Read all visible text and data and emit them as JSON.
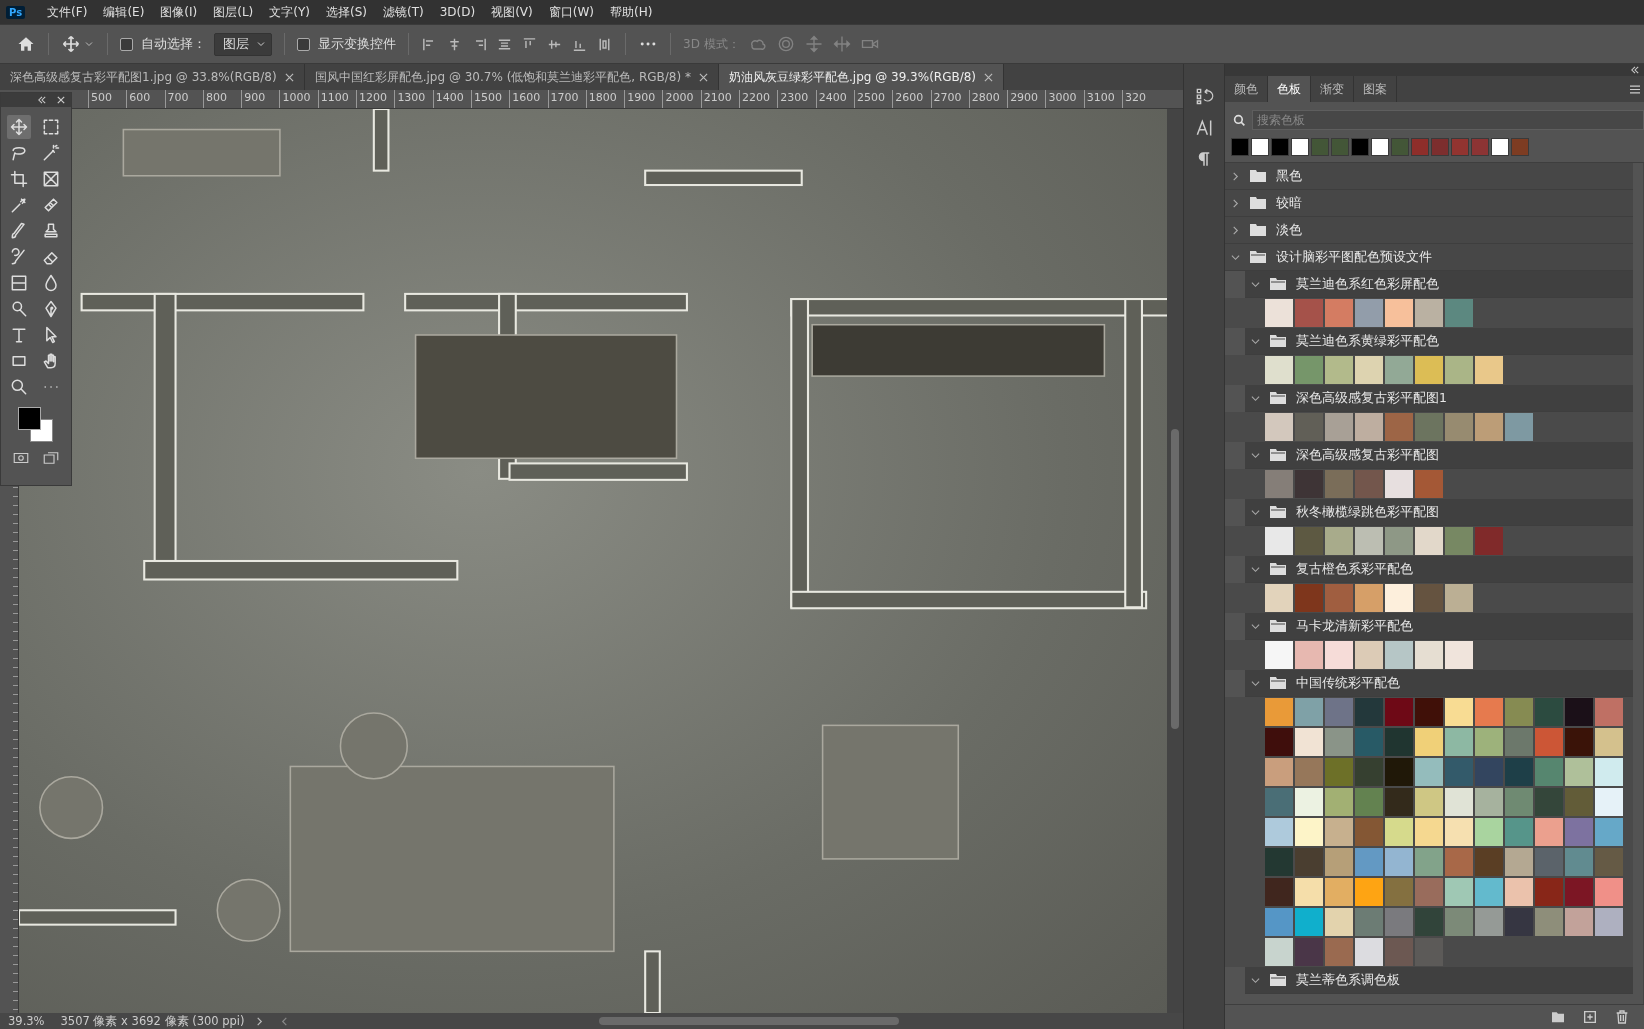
{
  "app": {
    "logo": "Ps"
  },
  "menu": [
    "文件(F)",
    "编辑(E)",
    "图像(I)",
    "图层(L)",
    "文字(Y)",
    "选择(S)",
    "滤镜(T)",
    "3D(D)",
    "视图(V)",
    "窗口(W)",
    "帮助(H)"
  ],
  "options_bar": {
    "auto_select": {
      "label": "自动选择：",
      "checked": false
    },
    "layer_dropdown": "图层",
    "show_transform": {
      "label": "显示变换控件",
      "checked": false
    },
    "mode_3d": "3D 模式："
  },
  "document_tabs": [
    {
      "title": "深色高级感复古彩平配图1.jpg @ 33.8%(RGB/8)",
      "selected": false
    },
    {
      "title": "国风中国红彩屏配色.jpg @ 30.7% (低饱和莫兰迪彩平配色, RGB/8) *",
      "selected": false
    },
    {
      "title": "奶油风灰豆绿彩平配色.jpg @ 39.3%(RGB/8)",
      "selected": true
    }
  ],
  "ruler_marks": [
    "500",
    "600",
    "700",
    "800",
    "900",
    "1000",
    "1100",
    "1200",
    "1300",
    "1400",
    "1500",
    "1600",
    "1700",
    "1800",
    "1900",
    "2000",
    "2100",
    "2200",
    "2300",
    "2400",
    "2500",
    "2600",
    "2700",
    "2800",
    "2900",
    "3000",
    "3100",
    "320"
  ],
  "status_bar": {
    "zoom": "39.3%",
    "info": "3507 像素 x 3692 像素 (300 ppi)"
  },
  "panel": {
    "tabs": [
      {
        "label": "颜色",
        "selected": false
      },
      {
        "label": "色板",
        "selected": true
      },
      {
        "label": "渐变",
        "selected": false
      },
      {
        "label": "图案",
        "selected": false
      }
    ],
    "search": {
      "placeholder": "搜索色板"
    },
    "recent": [
      {
        "color": "#000000"
      },
      {
        "color": "#ffffff"
      },
      {
        "color": "#000000"
      },
      {
        "color": "#ffffff"
      },
      {
        "color": "#435637"
      },
      {
        "color": "#435637"
      },
      {
        "color": "#000000"
      },
      {
        "color": "#ffffff"
      },
      {
        "color": "#435637"
      },
      {
        "color": "#8e2e2a"
      },
      {
        "color": "#7c2e2e"
      },
      {
        "color": "#923430"
      },
      {
        "color": "#8c3434"
      },
      {
        "color": "#ffffff"
      },
      {
        "color": "#7d3c22"
      }
    ],
    "groups": [
      {
        "name": "黑色",
        "expanded": false
      },
      {
        "name": "较暗",
        "expanded": false
      },
      {
        "name": "淡色",
        "expanded": false
      },
      {
        "name": "设计脑彩平图配色预设文件",
        "expanded": true,
        "children": [
          {
            "name": "莫兰迪色系红色彩屏配色",
            "expanded": true,
            "swatches": [
              {
                "color": "#ece1d9"
              },
              {
                "color": "#a5524a"
              },
              {
                "color": "#d47c62"
              },
              {
                "color": "#929daa"
              },
              {
                "color": "#f7c09b"
              },
              {
                "color": "#bab1a2"
              },
              {
                "color": "#5c8880"
              }
            ]
          },
          {
            "name": "莫兰迪色系黄绿彩平配色",
            "expanded": true,
            "swatches": [
              {
                "color": "#dfdfcd"
              },
              {
                "color": "#76966a"
              },
              {
                "color": "#b2ba8b"
              },
              {
                "color": "#ddd3b0"
              },
              {
                "color": "#92a996"
              },
              {
                "color": "#dcbd55"
              },
              {
                "color": "#aab587"
              },
              {
                "color": "#e9c88a"
              }
            ]
          },
          {
            "name": "深色高级感复古彩平配图1",
            "expanded": true,
            "swatches": [
              {
                "color": "#d3c8bd"
              },
              {
                "color": "#615f57"
              },
              {
                "color": "#a8a096"
              },
              {
                "color": "#beaea0"
              },
              {
                "color": "#9d6546"
              },
              {
                "color": "#6c745f"
              },
              {
                "color": "#978b70"
              },
              {
                "color": "#bc9d77"
              },
              {
                "color": "#7e99a2"
              }
            ]
          },
          {
            "name": "深色高级感复古彩平配图",
            "expanded": true,
            "swatches": [
              {
                "color": "#857e78"
              },
              {
                "color": "#3e3436"
              },
              {
                "color": "#7a6d59"
              },
              {
                "color": "#73564c"
              },
              {
                "color": "#e7dfdf"
              },
              {
                "color": "#a45836"
              }
            ]
          },
          {
            "name": "秋冬橄榄绿跳色彩平配图",
            "expanded": true,
            "swatches": [
              {
                "color": "#e8e8e8"
              },
              {
                "color": "#5d5942"
              },
              {
                "color": "#a8ab8b"
              },
              {
                "color": "#bcbeb2"
              },
              {
                "color": "#8e9886"
              },
              {
                "color": "#e2d8ca"
              },
              {
                "color": "#778863"
              },
              {
                "color": "#802a2a"
              }
            ]
          },
          {
            "name": "复古橙色系彩平配色",
            "expanded": true,
            "swatches": [
              {
                "color": "#e2d3bb"
              },
              {
                "color": "#7e361c"
              },
              {
                "color": "#a05e40"
              },
              {
                "color": "#d69f68"
              },
              {
                "color": "#fdefdc"
              },
              {
                "color": "#655340"
              },
              {
                "color": "#bbaf94"
              }
            ]
          },
          {
            "name": "马卡龙清新彩平配色",
            "expanded": true,
            "swatches": [
              {
                "color": "#f6f6f6"
              },
              {
                "color": "#e7b8b0"
              },
              {
                "color": "#f6dcd8"
              },
              {
                "color": "#dccbb6"
              },
              {
                "color": "#b6c6c6"
              },
              {
                "color": "#e6ded2"
              },
              {
                "color": "#f0e4dc"
              }
            ]
          },
          {
            "name": "中国传统彩平配色",
            "expanded": true,
            "swatches": [
              {
                "color": "#e99a38"
              },
              {
                "color": "#7fa1a7"
              },
              {
                "color": "#6e7388"
              },
              {
                "color": "#23383b"
              },
              {
                "color": "#6e0916"
              },
              {
                "color": "#401008"
              },
              {
                "color": "#f8dc93"
              },
              {
                "color": "#e67a4e"
              },
              {
                "color": "#868b52"
              },
              {
                "color": "#2c4b40"
              },
              {
                "color": "#1b1018"
              },
              {
                "color": "#bf7064"
              },
              {
                "color": "#3f0e0c"
              },
              {
                "color": "#f1e3d4"
              },
              {
                "color": "#8a9488"
              },
              {
                "color": "#285a66"
              },
              {
                "color": "#203530"
              },
              {
                "color": "#f0d078"
              },
              {
                "color": "#8db8a3"
              },
              {
                "color": "#9db27b"
              },
              {
                "color": "#6c786b"
              },
              {
                "color": "#cc5636"
              },
              {
                "color": "#3a1308"
              },
              {
                "color": "#d4c18d"
              },
              {
                "color": "#c99e7d"
              },
              {
                "color": "#96775a"
              },
              {
                "color": "#6d7028"
              },
              {
                "color": "#364030"
              },
              {
                "color": "#201808"
              },
              {
                "color": "#94bcbc"
              },
              {
                "color": "#335a6a"
              },
              {
                "color": "#33455f"
              },
              {
                "color": "#1e3f48"
              },
              {
                "color": "#56866f"
              },
              {
                "color": "#afc09a"
              },
              {
                "color": "#d0ebee"
              },
              {
                "color": "#4a6e76"
              },
              {
                "color": "#ecf2e2"
              },
              {
                "color": "#a2b073"
              },
              {
                "color": "#638250"
              },
              {
                "color": "#332a1b"
              },
              {
                "color": "#cfc784"
              },
              {
                "color": "#e0e3d6"
              },
              {
                "color": "#a6b29e"
              },
              {
                "color": "#6f8a72"
              },
              {
                "color": "#34463a"
              },
              {
                "color": "#625c38"
              },
              {
                "color": "#e6f2f8"
              },
              {
                "color": "#aecadc"
              },
              {
                "color": "#fdf4c8"
              },
              {
                "color": "#c7b08e"
              },
              {
                "color": "#845734"
              },
              {
                "color": "#d6da8c"
              },
              {
                "color": "#f5d890"
              },
              {
                "color": "#f6e0b0"
              },
              {
                "color": "#a9d49f"
              },
              {
                "color": "#56958a"
              },
              {
                "color": "#eba08e"
              },
              {
                "color": "#7d72a0"
              },
              {
                "color": "#66a8c8"
              },
              {
                "color": "#233832"
              },
              {
                "color": "#4a3e30"
              },
              {
                "color": "#b69f78"
              },
              {
                "color": "#6399c3"
              },
              {
                "color": "#93b5d1"
              },
              {
                "color": "#82a38a"
              },
              {
                "color": "#a86848"
              },
              {
                "color": "#5a3e24"
              },
              {
                "color": "#b4a892"
              },
              {
                "color": "#5b636a"
              },
              {
                "color": "#618b90"
              },
              {
                "color": "#655a45"
              },
              {
                "color": "#40261e"
              },
              {
                "color": "#f5deaa"
              },
              {
                "color": "#e2ae62"
              },
              {
                "color": "#fea413"
              },
              {
                "color": "#847040"
              },
              {
                "color": "#996c5c"
              },
              {
                "color": "#9fc8b4"
              },
              {
                "color": "#63bacd"
              },
              {
                "color": "#ebc2ac"
              },
              {
                "color": "#882618"
              },
              {
                "color": "#7c1624"
              },
              {
                "color": "#f09088"
              },
              {
                "color": "#5596c6"
              },
              {
                "color": "#10afcc"
              },
              {
                "color": "#e3d3ad"
              },
              {
                "color": "#6c7c74"
              },
              {
                "color": "#7a7a7e"
              },
              {
                "color": "#31443a"
              },
              {
                "color": "#7c8a78"
              },
              {
                "color": "#959a96"
              },
              {
                "color": "#363642"
              },
              {
                "color": "#8e8e7a"
              },
              {
                "color": "#c2a29a"
              },
              {
                "color": "#aeb0c0"
              },
              {
                "color": "#c8d4ce"
              },
              {
                "color": "#4a3648"
              },
              {
                "color": "#9a6a50"
              },
              {
                "color": "#dcdce0"
              },
              {
                "color": "#6c5852"
              },
              {
                "color": "#5c5a58"
              }
            ]
          },
          {
            "name": "莫兰蒂色系调色板",
            "expanded": true
          }
        ]
      }
    ]
  }
}
